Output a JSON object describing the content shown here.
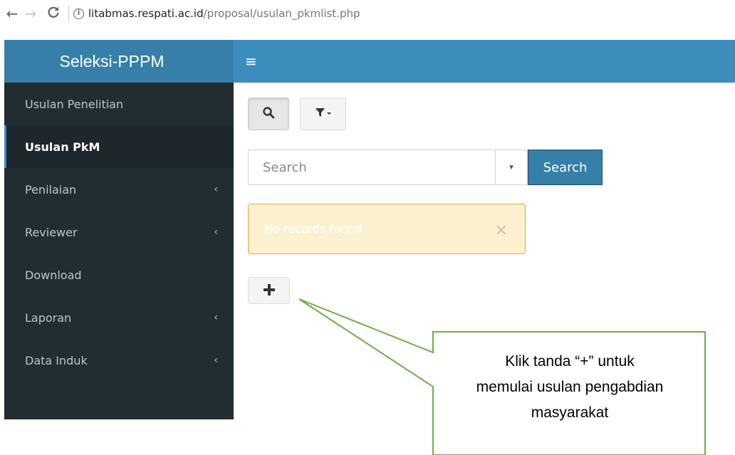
{
  "browser": {
    "back_icon": "←",
    "forward_icon": "→",
    "reload_icon": "C",
    "info_icon": "i",
    "url_host": "litabmas.respati.ac.id",
    "url_path": "/proposal/usulan_pkmlist.php"
  },
  "sidebar": {
    "logo": "Seleksi-PPPM",
    "items": [
      {
        "label": "Usulan Penelitian",
        "has_submenu": false,
        "active": false
      },
      {
        "label": "Usulan PkM",
        "has_submenu": false,
        "active": true
      },
      {
        "label": "Penilaian",
        "has_submenu": true,
        "active": false
      },
      {
        "label": "Reviewer",
        "has_submenu": true,
        "active": false
      },
      {
        "label": "Download",
        "has_submenu": false,
        "active": false
      },
      {
        "label": "Laporan",
        "has_submenu": true,
        "active": false
      },
      {
        "label": "Data Induk",
        "has_submenu": true,
        "active": false
      }
    ],
    "chevron_icon": "‹"
  },
  "header": {
    "menu_icon": "≡"
  },
  "toolbar": {
    "search_toggle_icon": "🔍",
    "filter_icon": "▼▾"
  },
  "search": {
    "placeholder": "Search",
    "dropdown_icon": "▼",
    "button_label": "Search"
  },
  "alert": {
    "message": "No records found",
    "close_icon": "×"
  },
  "add_button": {
    "icon": "+"
  },
  "callout": {
    "line1": "Klik tanda “+” untuk",
    "line2": "memulai usulan pengabdian",
    "line3": "masyarakat"
  },
  "colors": {
    "sidebar_bg": "#222d32",
    "logo_bg": "#367fa9",
    "header_bg": "#3c8dbc",
    "callout_border": "#70ad47",
    "alert_bg": "#fcf1cf",
    "alert_border": "#f0a443"
  }
}
